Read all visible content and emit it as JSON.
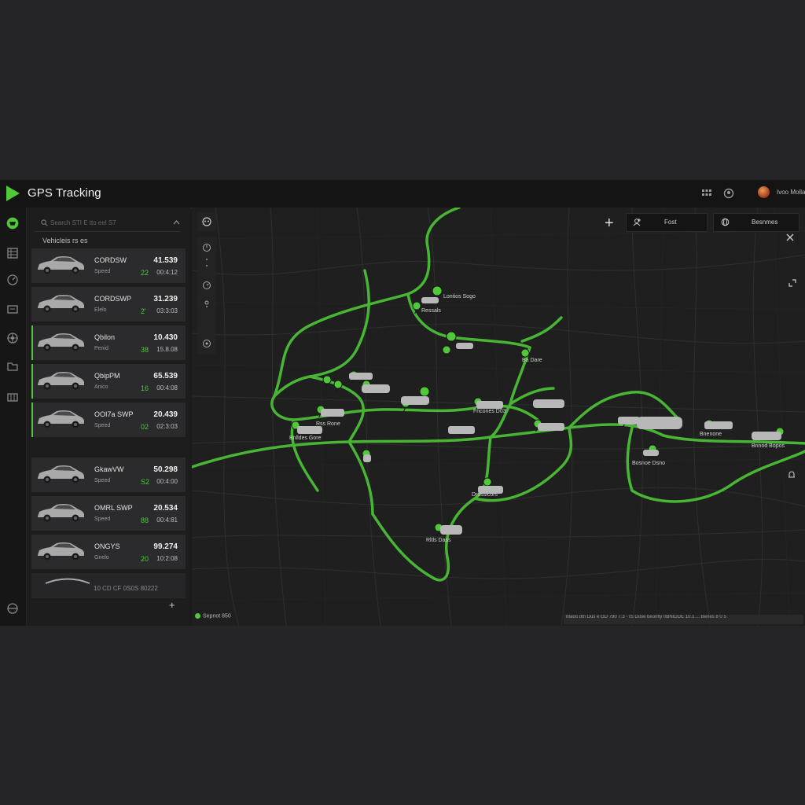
{
  "app": {
    "title": "GPS Tracking",
    "user_name": "Ivoo Mollar"
  },
  "colors": {
    "accent": "#4fc83a",
    "background": "#1b1b1c",
    "card": "#2b2b2d",
    "route": "#4bb838"
  },
  "icons": {
    "logo": "play-triangle-icon",
    "grid": "grid-icon",
    "profile": "user-circle-icon",
    "avatar": "avatar-icon"
  },
  "sidebar": {
    "items": [
      {
        "name": "sidebar-item-dashboard",
        "icon": "map-pin-icon",
        "active": true
      },
      {
        "name": "sidebar-item-reports",
        "icon": "table-icon"
      },
      {
        "name": "sidebar-item-speed",
        "icon": "speedometer-icon"
      },
      {
        "name": "sidebar-item-screen",
        "icon": "monitor-icon"
      },
      {
        "name": "sidebar-item-wheel",
        "icon": "wheel-icon"
      },
      {
        "name": "sidebar-item-media",
        "icon": "folder-icon"
      },
      {
        "name": "sidebar-item-garage",
        "icon": "building-icon"
      },
      {
        "name": "sidebar-item-transit",
        "icon": "transit-icon"
      }
    ]
  },
  "panel": {
    "search_placeholder": "Search    STI E   tto eel S7",
    "section_label": "Vehicleis rs es",
    "footer_text": "10 CD CF 0S0S 80222",
    "vehicles": [
      {
        "name": "CORDSW",
        "sub": "Speed",
        "value": "41.539",
        "num": "22",
        "time": "00:4:12",
        "accent": false
      },
      {
        "name": "CORDSWP",
        "sub": "Elelo",
        "value": "31.239",
        "num": "2'",
        "time": "03:3:03",
        "accent": false
      },
      {
        "name": "Qbilon",
        "sub": "Penid",
        "value": "10.430",
        "num": "38",
        "time": "15.8.08",
        "accent": true
      },
      {
        "name": "QbipPM",
        "sub": "Anico",
        "value": "65.539",
        "num": "16",
        "time": "00:4:08",
        "accent": true
      },
      {
        "name": "OOI7a SWP",
        "sub": "Speed",
        "value": "20.439",
        "num": "02",
        "time": "02:3:03",
        "accent": true
      },
      {
        "name": "GkawVW",
        "sub": "Speed",
        "value": "50.298",
        "num": "S2",
        "time": "00:4:00",
        "accent": false
      },
      {
        "name": "OMRL SWP",
        "sub": "Speed",
        "value": "20.534",
        "num": "88",
        "time": "00:4:81",
        "accent": false
      },
      {
        "name": "ONGYS",
        "sub": "Gnelo",
        "value": "99.274",
        "num": "20",
        "time": "10:2:08",
        "accent": false
      }
    ]
  },
  "map": {
    "buttons": {
      "plus": "+",
      "first": "Fost",
      "second": "Besnmes"
    },
    "brand": "Sepnot 850",
    "attribution": "Maoo dtn Dus e GD 790 7.3 · IS Dose beonfly 0BNIDDE 10.1 ... Benes 8 0 5",
    "labels": [
      {
        "text": "Lontios Sogo"
      },
      {
        "text": "Ressals"
      },
      {
        "text": "Ba Dare"
      },
      {
        "text": "Rss Rone"
      },
      {
        "text": "Bnlldes Gore"
      },
      {
        "text": "Fncones D03"
      },
      {
        "text": "Bnenone"
      },
      {
        "text": "Bnnod Bopos"
      },
      {
        "text": "Bosnoe Dsno"
      },
      {
        "text": "Drossicors"
      },
      {
        "text": "Rltls Dass"
      }
    ]
  }
}
